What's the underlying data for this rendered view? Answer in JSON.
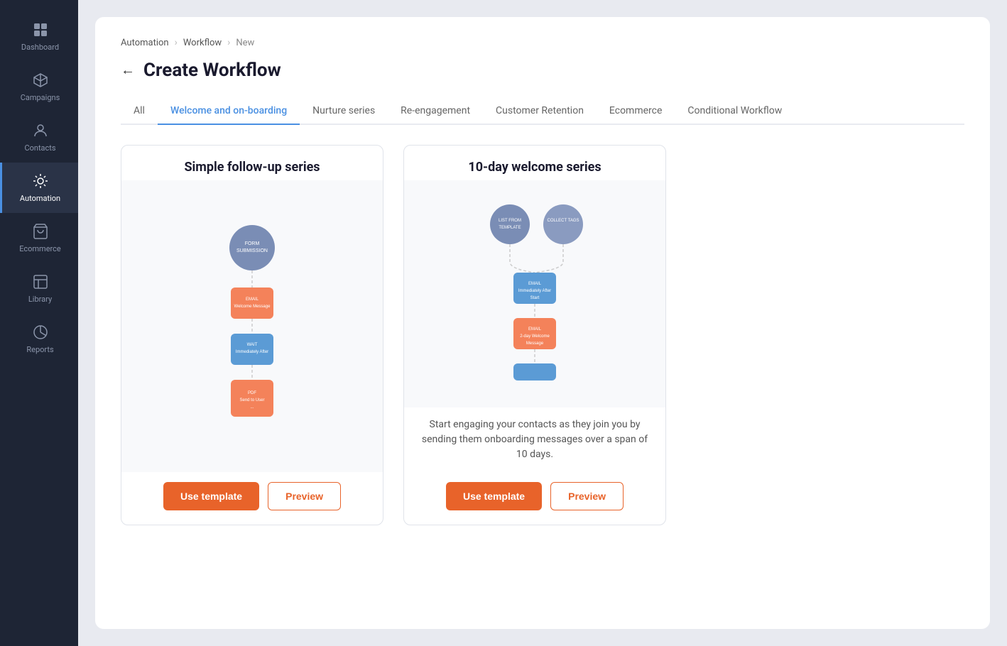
{
  "sidebar": {
    "items": [
      {
        "id": "dashboard",
        "label": "Dashboard",
        "icon": "dashboard"
      },
      {
        "id": "campaigns",
        "label": "Campaigns",
        "icon": "campaigns"
      },
      {
        "id": "contacts",
        "label": "Contacts",
        "icon": "contacts"
      },
      {
        "id": "automation",
        "label": "Automation",
        "icon": "automation",
        "active": true
      },
      {
        "id": "ecommerce",
        "label": "Ecommerce",
        "icon": "ecommerce"
      },
      {
        "id": "library",
        "label": "Library",
        "icon": "library"
      },
      {
        "id": "reports",
        "label": "Reports",
        "icon": "reports"
      }
    ]
  },
  "breadcrumb": {
    "items": [
      "Automation",
      "Workflow",
      "New"
    ],
    "separators": [
      ">",
      ">"
    ]
  },
  "page": {
    "title": "Create Workflow",
    "back_label": "←"
  },
  "tabs": [
    {
      "id": "all",
      "label": "All"
    },
    {
      "id": "welcome",
      "label": "Welcome and on-boarding",
      "active": true
    },
    {
      "id": "nurture",
      "label": "Nurture series"
    },
    {
      "id": "reengagement",
      "label": "Re-engagement"
    },
    {
      "id": "retention",
      "label": "Customer Retention"
    },
    {
      "id": "ecommerce",
      "label": "Ecommerce"
    },
    {
      "id": "conditional",
      "label": "Conditional Workflow"
    }
  ],
  "templates": [
    {
      "id": "simple-followup",
      "title": "Simple follow-up series",
      "description": "",
      "use_template_label": "Use template",
      "preview_label": "Preview"
    },
    {
      "id": "ten-day-welcome",
      "title": "10-day welcome series",
      "description": "Start engaging your contacts as they join you by sending them onboarding messages over a span of 10 days.",
      "use_template_label": "Use template",
      "preview_label": "Preview"
    }
  ]
}
